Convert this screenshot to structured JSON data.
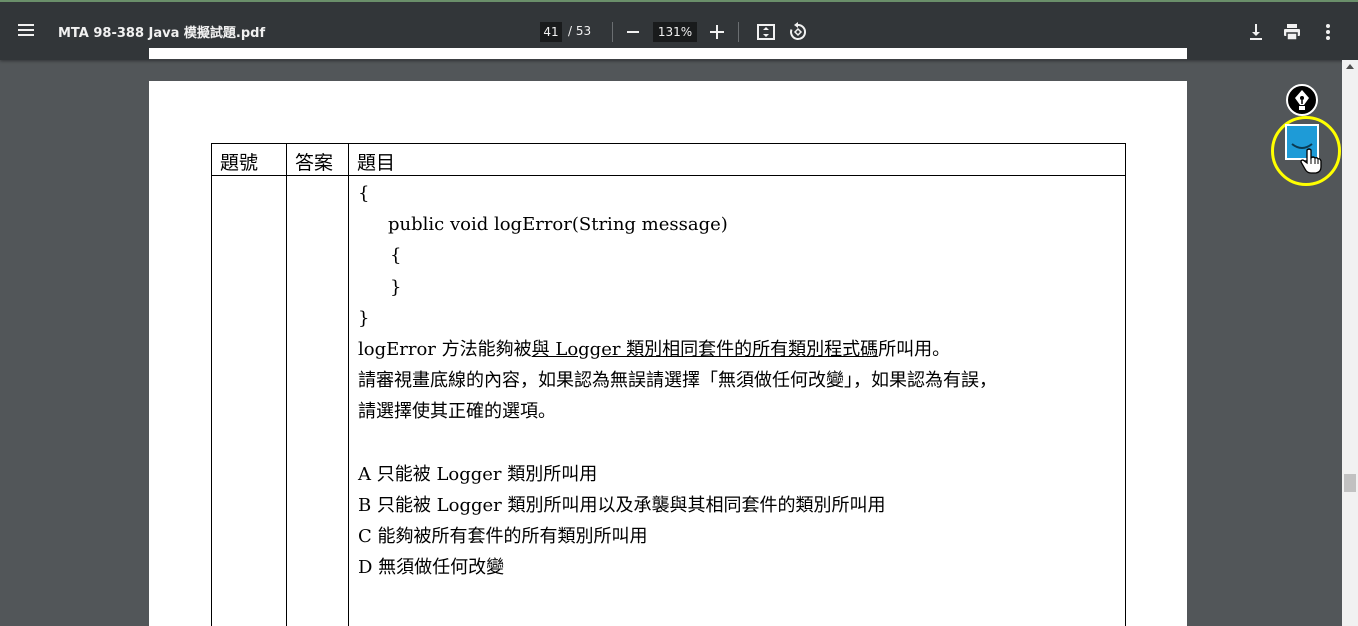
{
  "toolbar": {
    "title": "MTA 98-388 Java 模擬試題.pdf",
    "page_current": "41",
    "page_total": "/ 53",
    "zoom_level": "131%"
  },
  "icons": {
    "menu": "menu-icon",
    "zoom_out": "minus-icon",
    "zoom_in": "plus-icon",
    "fit": "fit-to-page-icon",
    "rotate": "rotate-icon",
    "download": "download-icon",
    "print": "print-icon",
    "more": "more-vert-icon",
    "pen": "pen-nib-icon",
    "cursor": "hand-pointer-icon"
  },
  "colors": {
    "toolbar_bg": "#323639",
    "viewer_bg": "#525659",
    "extension_accent": "#1e9bd7",
    "highlight_ring": "#ffff00"
  },
  "table": {
    "headers": [
      "題號",
      "答案",
      "題目"
    ],
    "code_lines": [
      "{",
      "public void logError(String message)",
      "{",
      "}",
      "}"
    ],
    "statement_pre": "logError 方法能夠被",
    "statement_underlined": "與 Logger 類別相同套件的所有類別程式碼",
    "statement_post": "所叫用。",
    "instruction_1": "請審視畫底線的內容，如果認為無誤請選擇「無須做任何改變」，如果認為有誤，",
    "instruction_2": "請選擇使其正確的選項。",
    "options": [
      "A 只能被 Logger 類別所叫用",
      "B 只能被 Logger 類別所叫用以及承襲與其相同套件的類別所叫用",
      "C 能夠被所有套件的所有類別所叫用",
      "D 無須做任何改變"
    ]
  }
}
